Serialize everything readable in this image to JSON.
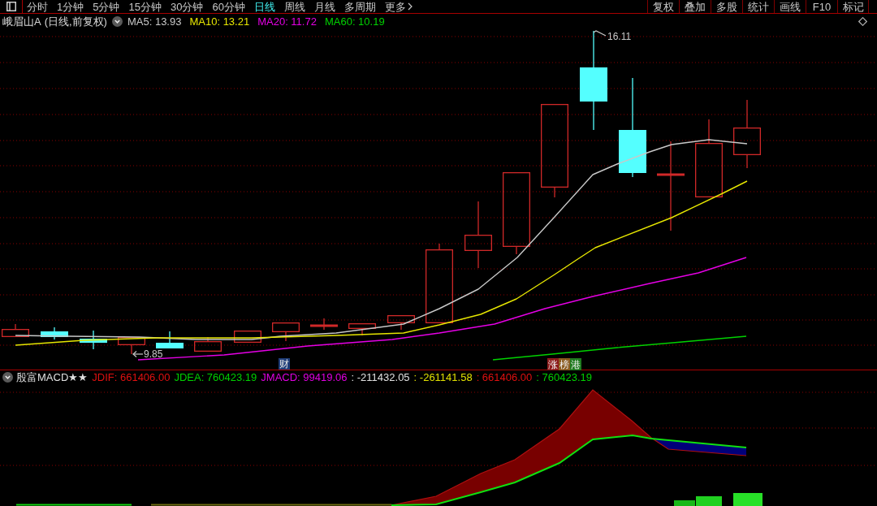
{
  "toolbar": {
    "periods": [
      {
        "label": "分时",
        "selected": false
      },
      {
        "label": "1分钟",
        "selected": false
      },
      {
        "label": "5分钟",
        "selected": false
      },
      {
        "label": "15分钟",
        "selected": false
      },
      {
        "label": "30分钟",
        "selected": false
      },
      {
        "label": "60分钟",
        "selected": false
      },
      {
        "label": "日线",
        "selected": true
      },
      {
        "label": "周线",
        "selected": false
      },
      {
        "label": "月线",
        "selected": false
      },
      {
        "label": "多周期",
        "selected": false
      }
    ],
    "more": "更多",
    "tools": [
      "复权",
      "叠加",
      "多股",
      "统计",
      "画线",
      "F10",
      "标记"
    ]
  },
  "legend": {
    "stock_name": "峨眉山A",
    "period_mode": "(日线,前复权)",
    "moving_averages": [
      {
        "label": "MA5: 13.93",
        "color": "#c8c8c8"
      },
      {
        "label": "MA10: 13.21",
        "color": "#e6e600"
      },
      {
        "label": "MA20: 11.72",
        "color": "#e600e6"
      },
      {
        "label": "MA60: 10.19",
        "color": "#00d200"
      }
    ]
  },
  "price_chart": {
    "high_label": "16.11",
    "low_label": "9.85",
    "event_badge": "财",
    "tags": [
      {
        "text": "涨",
        "color": "#8c1a1a"
      },
      {
        "text": "榜",
        "color": "#8a5a1e"
      },
      {
        "text": "港",
        "color": "#1e7a1e"
      }
    ]
  },
  "indicator": {
    "name": "殷富MACD★★",
    "readings": [
      {
        "text": "JDIF: 661406.00",
        "color": "#e01010"
      },
      {
        "text": "JDEA: 760423.19",
        "color": "#00d000"
      },
      {
        "text": "JMACD: 99419.06",
        "color": "#e000e0"
      },
      {
        "text": ": -211432.05",
        "color": "#e0e0e0"
      },
      {
        "text": ": -261141.58",
        "color": "#e0e000"
      },
      {
        "text": ": 661406.00",
        "color": "#e01010"
      },
      {
        "text": ": 760423.19",
        "color": "#00d000"
      }
    ]
  }
}
